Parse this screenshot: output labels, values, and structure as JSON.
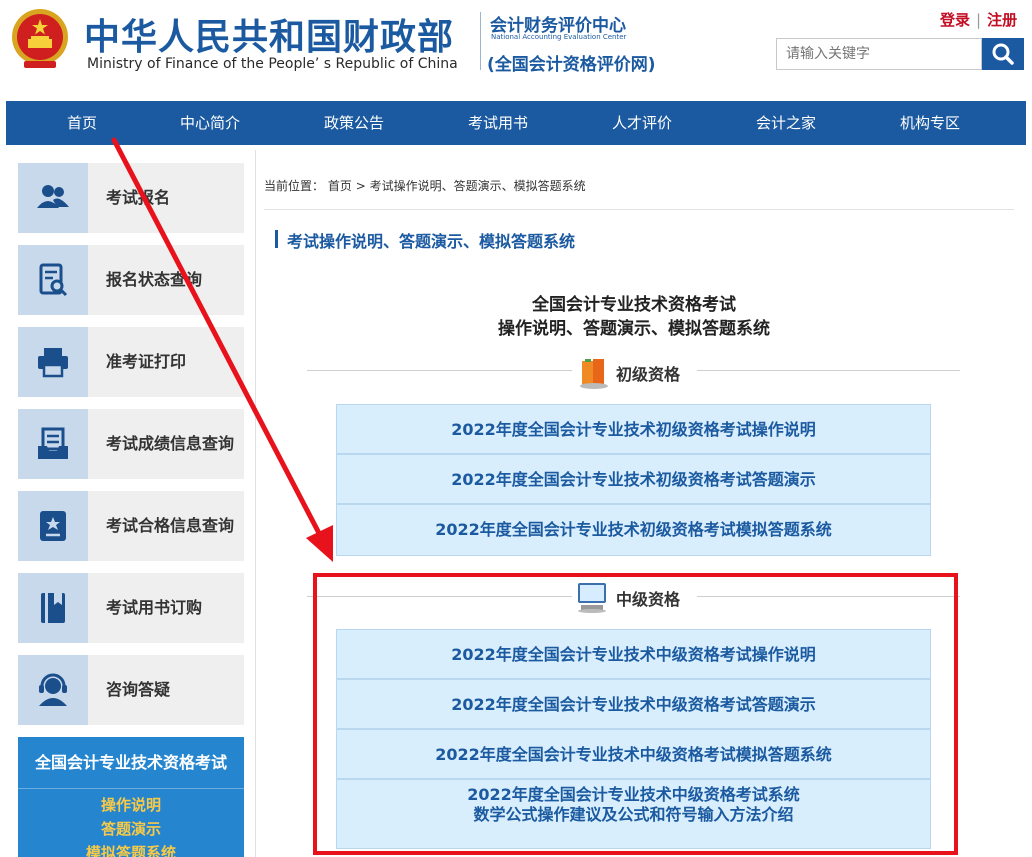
{
  "header": {
    "title_cn": "中华人民共和国财政部",
    "title_en": "Ministry of Finance of the People’ s Republic of China",
    "center_cn": "会计财务评价中心",
    "center_en": "National Accounting Evaluation Center",
    "center_sub": "(全国会计资格评价网)",
    "login": "登录",
    "register": "注册",
    "search_placeholder": "请输入关键字"
  },
  "nav": {
    "items": [
      {
        "label": "首页"
      },
      {
        "label": "中心简介"
      },
      {
        "label": "政策公告"
      },
      {
        "label": "考试用书"
      },
      {
        "label": "人才评价"
      },
      {
        "label": "会计之家"
      },
      {
        "label": "机构专区"
      }
    ]
  },
  "sidebar": {
    "items": [
      {
        "label": "考试报名",
        "icon": "people-icon"
      },
      {
        "label": "报名状态查询",
        "icon": "document-search-icon"
      },
      {
        "label": "准考证打印",
        "icon": "printer-icon"
      },
      {
        "label": "考试成绩信息查询",
        "icon": "inbox-icon"
      },
      {
        "label": "考试合格信息查询",
        "icon": "certificate-icon"
      },
      {
        "label": "考试用书订购",
        "icon": "book-icon"
      },
      {
        "label": "咨询答疑",
        "icon": "headset-icon"
      }
    ],
    "exam_box": {
      "title": "全国会计专业技术资格考试",
      "links": [
        "操作说明",
        "答题演示",
        "模拟答题系统"
      ]
    }
  },
  "main": {
    "breadcrumb_prefix": "当前位置：",
    "breadcrumb_home": "首页",
    "breadcrumb_sep": ">",
    "breadcrumb_current": "考试操作说明、答题演示、模拟答题系统",
    "section_title": "考试操作说明、答题演示、模拟答题系统",
    "intro_line1": "全国会计专业技术资格考试",
    "intro_line2": "操作说明、答题演示、模拟答题系统",
    "groups": [
      {
        "label": "初级资格",
        "icon": "books-icon",
        "links": [
          "2022年度全国会计专业技术初级资格考试操作说明",
          "2022年度全国会计专业技术初级资格考试答题演示",
          "2022年度全国会计专业技术初级资格考试模拟答题系统"
        ]
      },
      {
        "label": "中级资格",
        "icon": "computer-icon",
        "links": [
          "2022年度全国会计专业技术中级资格考试操作说明",
          "2022年度全国会计专业技术中级资格考试答题演示",
          "2022年度全国会计专业技术中级资格考试模拟答题系统"
        ],
        "extra_link_line1": "2022年度全国会计专业技术中级资格考试系统",
        "extra_link_line2": "数学公式操作建议及公式和符号输入方法介绍"
      }
    ]
  },
  "colors": {
    "brand_blue": "#1b5aa0",
    "annotation_red": "#e8121c",
    "link_bg": "#d9eefc"
  }
}
